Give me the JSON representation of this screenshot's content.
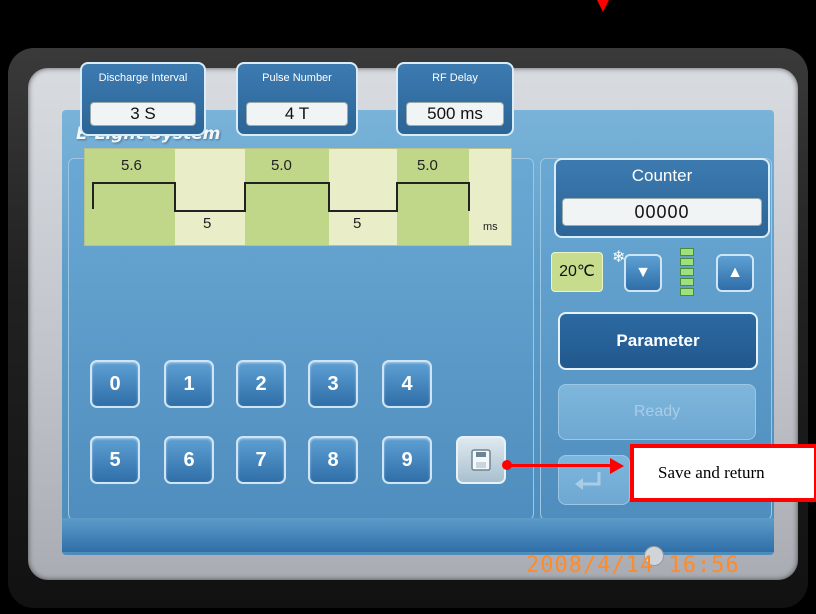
{
  "app": {
    "title": "E-Light System"
  },
  "params": [
    {
      "label": "Discharge Interval",
      "value": "3 S"
    },
    {
      "label": "Pulse Number",
      "value": "4 T"
    },
    {
      "label": "RF Delay",
      "value": "500 ms"
    }
  ],
  "waveform": {
    "high_labels": [
      "5.6",
      "5.0",
      "5.0"
    ],
    "low_labels": [
      "5",
      "5"
    ],
    "unit": "ms"
  },
  "keypad": {
    "row1": [
      "0",
      "1",
      "2",
      "3",
      "4"
    ],
    "row2": [
      "5",
      "6",
      "7",
      "8",
      "9"
    ]
  },
  "counter": {
    "label": "Counter",
    "value": "00000"
  },
  "temperature": {
    "value": "20℃"
  },
  "parameter_button": "Parameter",
  "ready_button": "Ready",
  "datetime": "2008/4/14   16:56",
  "annotation": {
    "text": "Save and return",
    "color": "#ff0000"
  },
  "icons": {
    "cool": "snowflake-icon",
    "down": "down-arrow-icon",
    "up": "up-arrow-icon",
    "save": "save-icon",
    "return": "return-icon",
    "level": "level-indicator-icon"
  }
}
